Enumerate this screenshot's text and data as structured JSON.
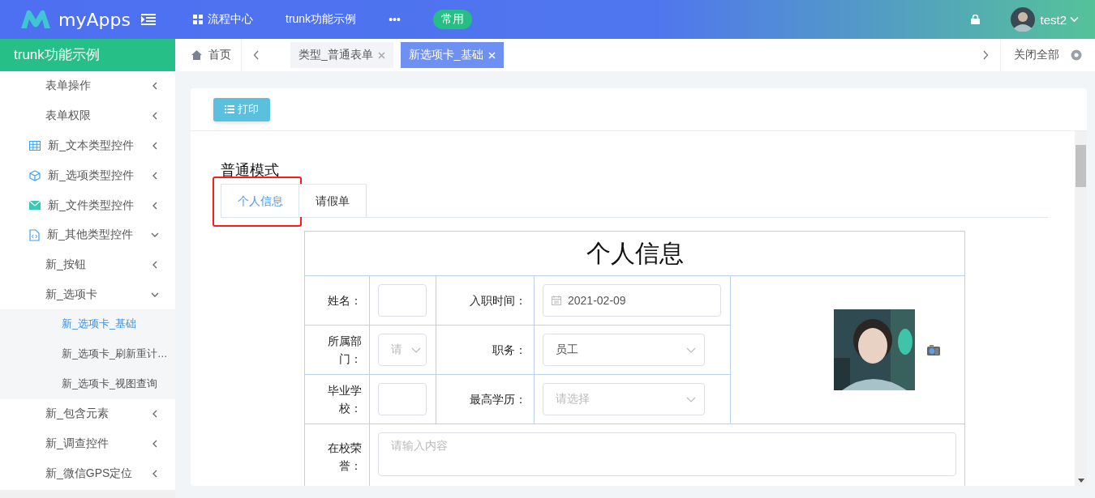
{
  "header": {
    "logo_text": "myApps",
    "nav": [
      {
        "label": "流程中心"
      },
      {
        "label": "trunk功能示例"
      },
      {
        "label": "•••"
      }
    ],
    "badge": "常用",
    "user": "test2"
  },
  "sidebar": {
    "title": "trunk功能示例",
    "items": [
      {
        "label": "表单操作",
        "expanded": false,
        "selected": false
      },
      {
        "label": "表单权限",
        "expanded": false,
        "selected": false
      },
      {
        "label": "新_文本类型控件",
        "expanded": false,
        "selected": false
      },
      {
        "label": "新_选项类型控件",
        "expanded": false,
        "selected": false
      },
      {
        "label": "新_文件类型控件",
        "expanded": false,
        "selected": false
      },
      {
        "label": "新_其他类型控件",
        "expanded": true,
        "selected": false,
        "children": [
          {
            "label": "新_按钮",
            "expanded": false,
            "selected": false
          },
          {
            "label": "新_选项卡",
            "expanded": true,
            "selected": false,
            "children": [
              {
                "label": "新_选项卡_基础",
                "selected": true
              },
              {
                "label": "新_选项卡_刷新重计…",
                "selected": false
              },
              {
                "label": "新_选项卡_视图查询",
                "selected": false
              }
            ]
          },
          {
            "label": "新_包含元素",
            "expanded": false,
            "selected": false
          },
          {
            "label": "新_调查控件",
            "expanded": false,
            "selected": false
          },
          {
            "label": "新_微信GPS定位",
            "expanded": false,
            "selected": false
          }
        ]
      }
    ]
  },
  "page_tabs": {
    "home": "首页",
    "tabs": [
      {
        "label": "类型_普通表单",
        "selected": false
      },
      {
        "label": "新选项卡_基础",
        "selected": true
      }
    ],
    "close_all": "关闭全部"
  },
  "toolbar": {
    "print_button": "打印"
  },
  "form": {
    "mode_title": "普通模式",
    "tabs": [
      {
        "label": "个人信息",
        "selected": true,
        "highlighted": true
      },
      {
        "label": "请假单",
        "selected": false,
        "highlighted": false
      }
    ],
    "table_title": "个人信息",
    "rows": [
      [
        {
          "label": "姓名：",
          "field": {
            "kind": "text"
          }
        },
        {
          "label": "入职时间：",
          "field": {
            "kind": "date",
            "value": "2021-02-09"
          }
        }
      ],
      [
        {
          "label": "所属部门：",
          "field": {
            "kind": "select",
            "placeholder": "请"
          }
        },
        {
          "label": "职务：",
          "field": {
            "kind": "select",
            "value": "员工"
          }
        }
      ],
      [
        {
          "label": "毕业学校：",
          "field": {
            "kind": "text"
          }
        },
        {
          "label": "最高学历：",
          "field": {
            "kind": "select",
            "placeholder": "请选择"
          }
        }
      ]
    ],
    "photo": {
      "kind": "picture"
    },
    "honors": {
      "label": "在校荣誉：",
      "placeholder": "请输入内容"
    }
  }
}
